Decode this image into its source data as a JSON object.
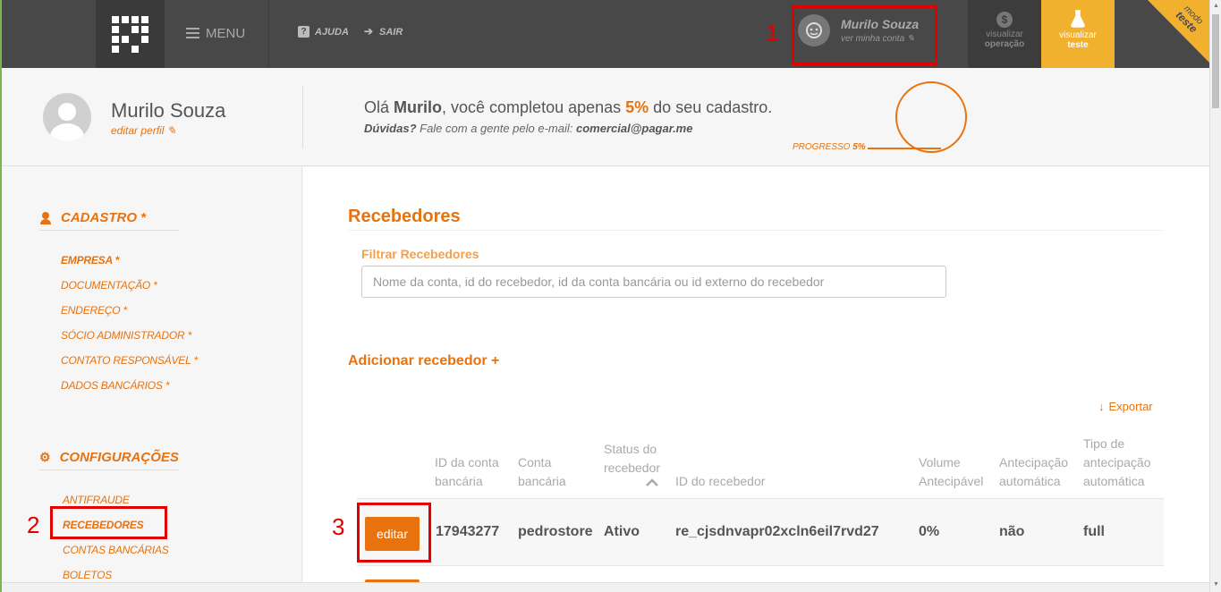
{
  "topbar": {
    "menu_label": "MENU",
    "help_label": "AJUDA",
    "logout_label": "SAIR",
    "user_name": "Murilo Souza",
    "user_sub": "ver minha conta",
    "view_operation": [
      "visualizar",
      "operação"
    ],
    "view_test": [
      "visualizar",
      "teste"
    ],
    "mode_badge": [
      "modo",
      "teste"
    ]
  },
  "profile": {
    "name": "Murilo Souza",
    "edit_label": "editar perfil",
    "greeting_prefix": "Olá ",
    "greeting_name": "Murilo",
    "greeting_mid": ", você completou apenas ",
    "greeting_pct": "5%",
    "greeting_suffix": " do seu cadastro.",
    "doubts_label": "Dúvidas?",
    "doubts_text": " Fale com a gente pelo e-mail: ",
    "doubts_email": "comercial@pagar.me",
    "progress_label": "PROGRESSO ",
    "progress_value": "5%",
    "progress_fraction": 0.05
  },
  "sidebar": {
    "cadastro_title": "CADASTRO *",
    "cadastro_items": [
      "EMPRESA *",
      "DOCUMENTAÇÃO *",
      "ENDEREÇO *",
      "SÓCIO ADMINISTRADOR *",
      "CONTATO RESPONSÁVEL *",
      "DADOS BANCÁRIOS *"
    ],
    "config_title": "CONFIGURAÇÕES",
    "config_items": [
      "ANTIFRAUDE",
      "RECEBEDORES",
      "CONTAS BANCÁRIAS",
      "BOLETOS"
    ]
  },
  "main": {
    "title": "Recebedores",
    "filter_label": "Filtrar Recebedores",
    "filter_placeholder": "Nome da conta, id do recebedor, id da conta bancária ou id externo do recebedor",
    "add_label": "Adicionar recebedor +",
    "export_label": "Exportar",
    "columns": [
      [
        "ID da conta",
        "bancária"
      ],
      [
        "Conta",
        "bancária"
      ],
      [
        "Status do",
        "recebedor"
      ],
      [
        "ID do recebedor"
      ],
      [
        "Volume",
        "Antecipável"
      ],
      [
        "Antecipação",
        "automática"
      ],
      [
        "Tipo de",
        "antecipação",
        "automática"
      ]
    ],
    "rows": [
      {
        "edit_label": "editar",
        "cells": [
          "17943277",
          "pedrostore",
          "Ativo",
          "re_cjsdnvapr02xcln6eil7rvd27",
          "0%",
          "não",
          "full"
        ]
      }
    ]
  },
  "annotations": [
    "1",
    "2",
    "3"
  ],
  "colors": {
    "accent": "#e8720d",
    "topbar": "#484848",
    "test_mode": "#f1b12e",
    "annotation": "#e00000"
  }
}
